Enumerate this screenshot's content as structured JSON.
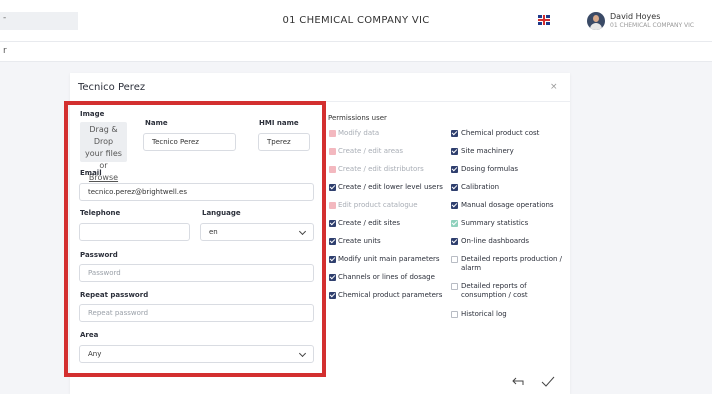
{
  "header": {
    "left_text": "-",
    "company": "01 CHEMICAL COMPANY VIC",
    "user_name": "David Hoyes",
    "user_company": "01 CHEMICAL COMPANY VIC"
  },
  "subbar": {
    "text": "r"
  },
  "modal": {
    "title": "Tecnico Perez",
    "close": "×"
  },
  "form": {
    "image_label": "Image",
    "drop_line1": "Drag & Drop",
    "drop_line2": "your files or",
    "drop_browse": "Browse",
    "name_label": "Name",
    "name_value": "Tecnico Perez",
    "hmi_label": "HMI name",
    "hmi_value": "Tperez",
    "email_label": "Email",
    "email_value": "tecnico.perez@brightwell.es",
    "telephone_label": "Telephone",
    "telephone_value": "",
    "language_label": "Language",
    "language_value": "en",
    "password_label": "Password",
    "password_placeholder": "Password",
    "repeat_label": "Repeat password",
    "repeat_placeholder": "Repeat password",
    "area_label": "Area",
    "area_value": "Any"
  },
  "permissions": {
    "title": "Permissions user",
    "left": [
      {
        "label": "Modify data",
        "state": "pink"
      },
      {
        "label": "Create / edit areas",
        "state": "pink"
      },
      {
        "label": "Create / edit distributors",
        "state": "pink"
      },
      {
        "label": "Create / edit lower level users",
        "state": "on"
      },
      {
        "label": "Edit product catalogue",
        "state": "pink"
      },
      {
        "label": "Create / edit sites",
        "state": "on"
      },
      {
        "label": "Create units",
        "state": "on"
      },
      {
        "label": "Modify unit main parameters",
        "state": "on"
      },
      {
        "label": "Channels or lines of dosage",
        "state": "on"
      },
      {
        "label": "Chemical product parameters",
        "state": "on"
      }
    ],
    "right": [
      {
        "label": "Chemical product cost",
        "state": "on"
      },
      {
        "label": "Site machinery",
        "state": "on"
      },
      {
        "label": "Dosing formulas",
        "state": "on"
      },
      {
        "label": "Calibration",
        "state": "on"
      },
      {
        "label": "Manual dosage operations",
        "state": "on"
      },
      {
        "label": "Summary statistics",
        "state": "on-light"
      },
      {
        "label": "On-line dashboards",
        "state": "on"
      },
      {
        "label": "Detailed reports production / alarm",
        "state": "off"
      },
      {
        "label": "Detailed reports of consumption / cost",
        "state": "off"
      },
      {
        "label": "Historical log",
        "state": "off"
      }
    ]
  },
  "colors": {
    "highlight": "#d32f2f",
    "checkbox_on": "#2f3f6e",
    "checkbox_disabled": "#f3b8bf"
  }
}
